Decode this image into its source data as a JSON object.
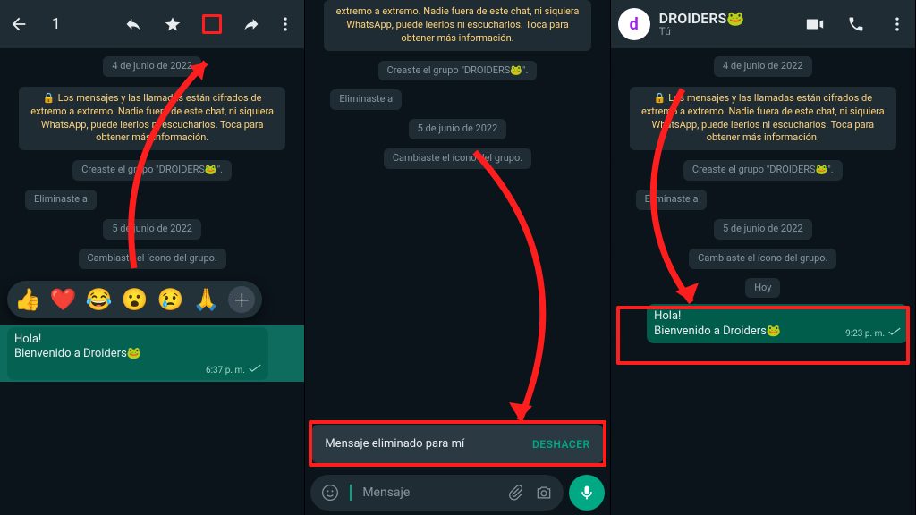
{
  "panel1": {
    "selection_count": "1",
    "date1": "4 de junio de 2022",
    "encryption": "Los mensajes y las llamadas están cifrados de extremo a extremo. Nadie fuera de este chat, ni siquiera WhatsApp, puede leerlos ni escucharlos. Toca para obtener más información.",
    "sys1": "Creaste el grupo \"DROIDERS🐸\".",
    "sys2": "Eliminaste a",
    "date2": "5 de junio de 2022",
    "sys3": "Cambiaste el ícono del grupo.",
    "reactions": [
      "👍",
      "❤️",
      "😂",
      "😮",
      "😢",
      "🙏"
    ],
    "msg_line1": "Hola!",
    "msg_line2": "Bienvenido a Droiders🐸",
    "msg_time": "6:37 p. m."
  },
  "panel2": {
    "enc_partial": "extremo a extremo. Nadie fuera de este chat, ni siquiera WhatsApp, puede leerlos ni escucharlos. Toca para obtener más información.",
    "sys1": "Creaste el grupo \"DROIDERS🐸\".",
    "sys2": "Eliminaste a",
    "date2": "5 de junio de 2022",
    "sys3": "Cambiaste el ícono del grupo.",
    "snackbar_text": "Mensaje eliminado para mí",
    "snackbar_action": "DESHACER",
    "input_placeholder": "Mensaje"
  },
  "panel3": {
    "group_name": "DROIDERS🐸",
    "subtitle": "Tú",
    "avatar_letter": "d",
    "date1": "4 de junio de 2022",
    "encryption": "Los mensajes y las llamadas están cifrados de extremo a extremo. Nadie fuera de este chat, ni siquiera WhatsApp, puede leerlos ni escucharlos. Toca para obtener más información.",
    "sys1": "Creaste el grupo \"DROIDERS🐸\".",
    "sys2": "Eliminaste a",
    "date2": "5 de junio de 2022",
    "sys3": "Cambiaste el ícono del grupo.",
    "today": "Hoy",
    "msg_line1": "Hola!",
    "msg_line2": "Bienvenido a Droiders🐸",
    "msg_time": "9:23 p. m."
  }
}
